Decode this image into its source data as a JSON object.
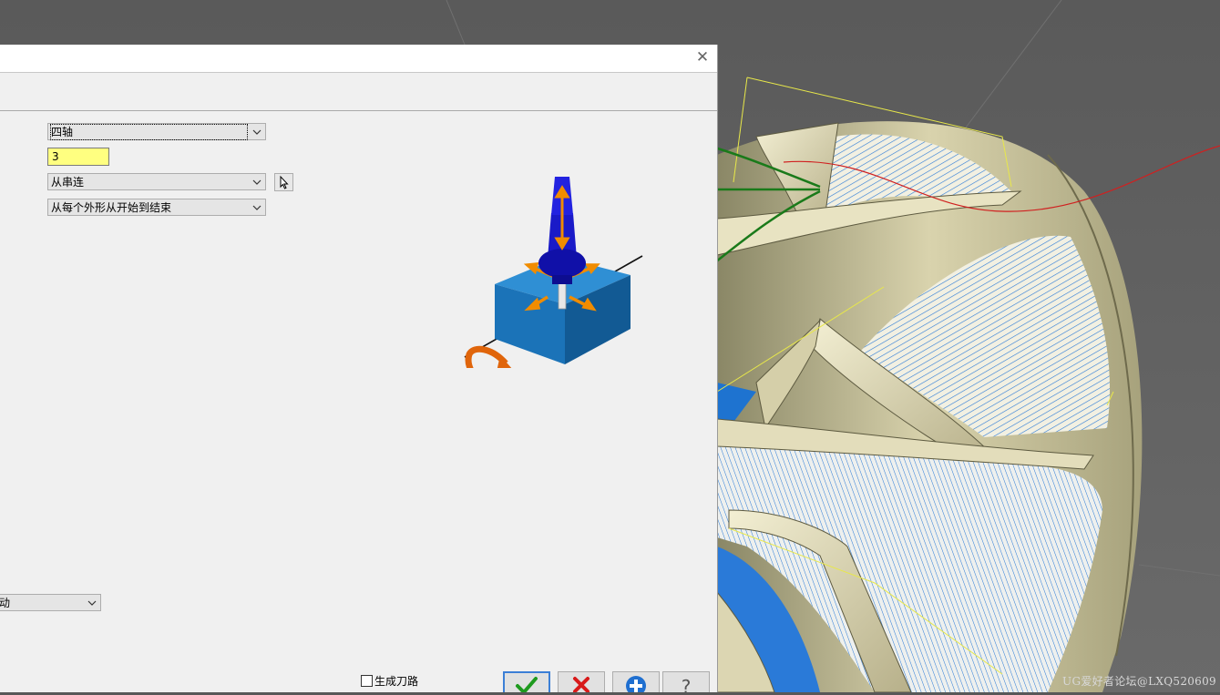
{
  "dialog": {
    "axis_type": "四轴",
    "tool_axis_value": "3",
    "chain_mode": "从串连",
    "cut_order": "从每个外形从开始到结束",
    "lower_combo": "动",
    "generate_toolpath": "生成刀路"
  },
  "buttons": {
    "ok": "check-icon",
    "cancel": "x-icon",
    "add": "plus-icon",
    "help": "question-icon"
  },
  "watermark": "UG爱好者论坛@LXQ520609",
  "colors": {
    "dialog_bg": "#f0f0f0",
    "highlight_field": "#ffff80",
    "annotation_green": "#1a7a1a",
    "toolpath_blue": "#1e73d0",
    "part_gold": "#cfc79a"
  }
}
